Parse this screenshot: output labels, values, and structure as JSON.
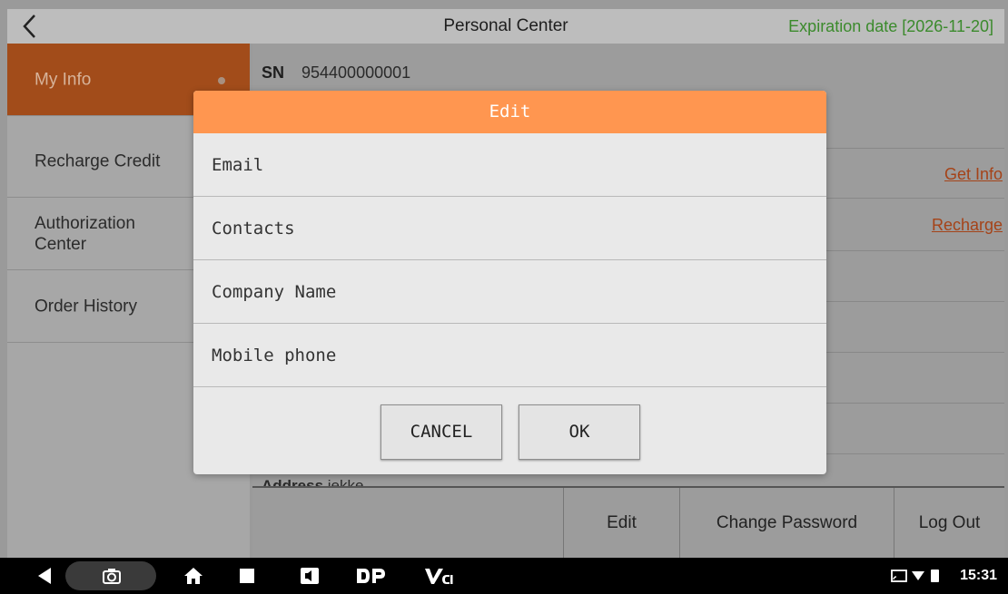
{
  "header": {
    "title": "Personal Center",
    "expiration": "Expiration date [2026-11-20]"
  },
  "sidebar": {
    "items": [
      {
        "label": "My Info",
        "active": true
      },
      {
        "label": "Recharge Credit"
      },
      {
        "label": "Authorization Center"
      },
      {
        "label": "Order History"
      }
    ]
  },
  "info": {
    "sn_label": "SN",
    "sn_value": "954400000001",
    "get_info_link": "Get Info",
    "recharge_link": "Recharge",
    "address_label": "Address",
    "address_value": "iekke"
  },
  "actions": {
    "edit": "Edit",
    "change_password": "Change Password",
    "log_out": "Log Out"
  },
  "dialog": {
    "title": "Edit",
    "fields": [
      {
        "placeholder": "Email",
        "value": ""
      },
      {
        "placeholder": "Contacts",
        "value": ""
      },
      {
        "placeholder": "Company Name",
        "value": ""
      },
      {
        "placeholder": "Mobile phone",
        "value": ""
      }
    ],
    "cancel": "CANCEL",
    "ok": "OK"
  },
  "status_bar": {
    "time": "15:31"
  },
  "colors": {
    "accent": "#ff9650",
    "active_tab": "#a24c1a",
    "link": "#a54318",
    "expiry": "#3b8a2c"
  }
}
